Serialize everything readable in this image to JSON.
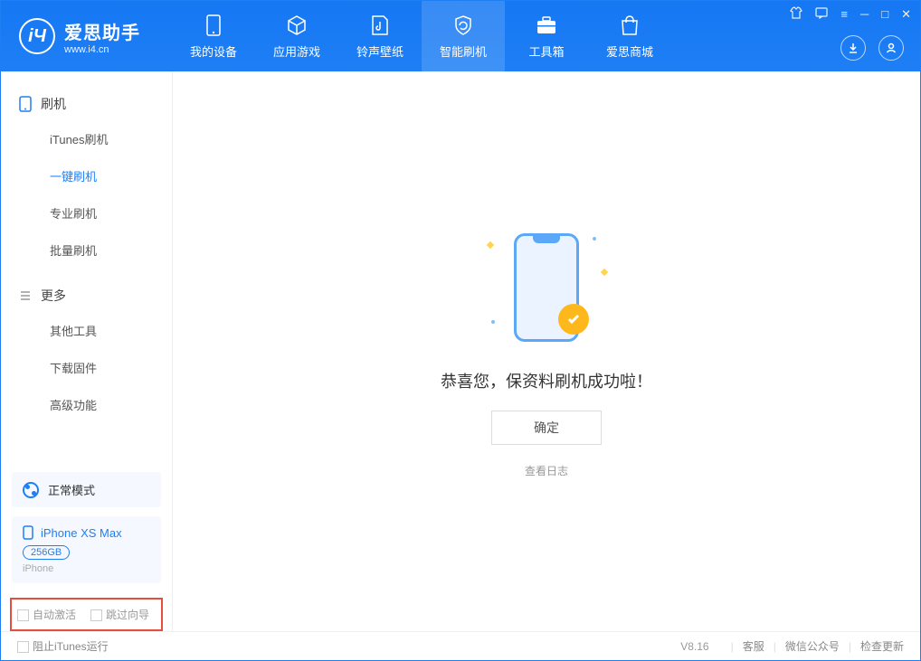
{
  "app": {
    "title": "爱思助手",
    "subtitle": "www.i4.cn"
  },
  "nav": {
    "tabs": [
      {
        "label": "我的设备"
      },
      {
        "label": "应用游戏"
      },
      {
        "label": "铃声壁纸"
      },
      {
        "label": "智能刷机"
      },
      {
        "label": "工具箱"
      },
      {
        "label": "爱思商城"
      }
    ]
  },
  "sidebar": {
    "group1_title": "刷机",
    "group1": [
      {
        "label": "iTunes刷机"
      },
      {
        "label": "一键刷机"
      },
      {
        "label": "专业刷机"
      },
      {
        "label": "批量刷机"
      }
    ],
    "group2_title": "更多",
    "group2": [
      {
        "label": "其他工具"
      },
      {
        "label": "下载固件"
      },
      {
        "label": "高级功能"
      }
    ],
    "mode_label": "正常模式",
    "device_name": "iPhone XS Max",
    "device_storage": "256GB",
    "device_type": "iPhone",
    "auto_activate": "自动激活",
    "skip_guide": "跳过向导"
  },
  "main": {
    "success_text": "恭喜您，保资料刷机成功啦！",
    "ok_button": "确定",
    "view_log": "查看日志"
  },
  "statusbar": {
    "block_itunes": "阻止iTunes运行",
    "version": "V8.16",
    "support": "客服",
    "wechat": "微信公众号",
    "update": "检查更新"
  }
}
